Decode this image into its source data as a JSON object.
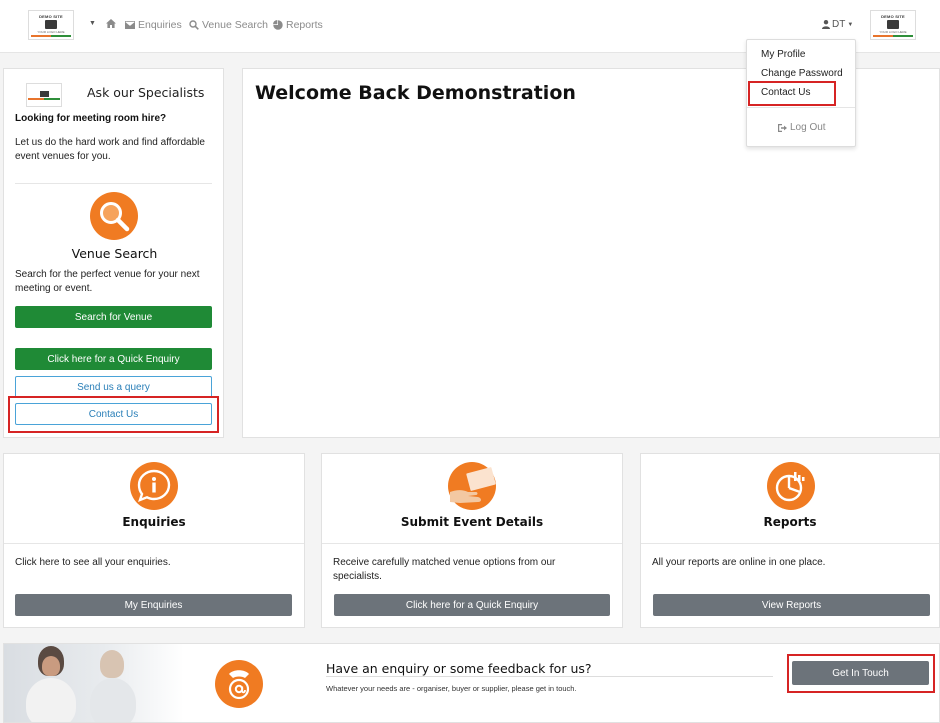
{
  "nav": {
    "logo_left": {
      "top": "DEMO SITE",
      "bottom": "YOUR LOGO HERE"
    },
    "logo_right": {
      "top": "DEMO SITE",
      "bottom": "YOUR LOGO HERE"
    },
    "items": [
      {
        "label": "Enquiries",
        "icon": "envelope-icon"
      },
      {
        "label": "Venue Search",
        "icon": "search-icon"
      },
      {
        "label": "Reports",
        "icon": "pie-chart-icon"
      }
    ],
    "user_initials": "DT"
  },
  "user_dropdown": {
    "items": [
      "My Profile",
      "Change Password",
      "Contact Us"
    ],
    "logout": "Log Out"
  },
  "sidebar": {
    "title": "Ask our Specialists",
    "heading": "Looking for meeting room hire?",
    "description": "Let us do the hard work and find affordable event venues for you.",
    "venue_title": "Venue Search",
    "venue_description": "Search for the perfect venue for your next meeting or event.",
    "buttons": {
      "search": "Search for Venue",
      "quick_enquiry": "Click here for a Quick Enquiry",
      "query": "Send us a query",
      "contact": "Contact Us"
    }
  },
  "welcome": {
    "heading": "Welcome Back Demonstration"
  },
  "features": [
    {
      "title": "Enquiries",
      "description": "Click here to see all your enquiries.",
      "button": "My Enquiries",
      "icon": "info-chat-icon"
    },
    {
      "title": "Submit Event Details",
      "description": "Receive carefully matched venue options from our specialists.",
      "button": "Click here for a Quick Enquiry",
      "icon": "hand-card-icon"
    },
    {
      "title": "Reports",
      "description": "All your reports are online in one place.",
      "button": "View Reports",
      "icon": "pie-chart-icon"
    }
  ],
  "banner": {
    "title": "Have an enquiry or some feedback for us?",
    "subtitle": "Whatever your needs are - organiser, buyer or supplier, please get in touch.",
    "button": "Get In Touch",
    "icon": "at-phone-icon"
  },
  "colors": {
    "accent": "#f07b22",
    "green": "#1f8a36",
    "grey_button": "#6c737a",
    "highlight": "#d62424",
    "outline": "#4aa3d8"
  }
}
